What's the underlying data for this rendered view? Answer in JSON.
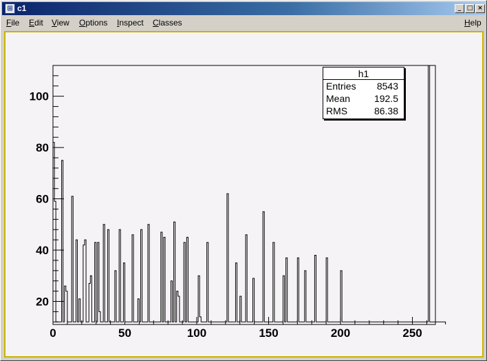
{
  "window": {
    "title": "c1",
    "icon": "root-canvas-icon",
    "controls": [
      "minimize-icon",
      "maximize-icon",
      "close-icon"
    ]
  },
  "menu": {
    "items": [
      "File",
      "Edit",
      "View",
      "Options",
      "Inspect",
      "Classes"
    ],
    "help": "Help"
  },
  "stats": {
    "title": "h1",
    "rows": [
      {
        "key": "Entries",
        "value": "8543"
      },
      {
        "key": "Mean",
        "value": "192.5"
      },
      {
        "key": "RMS",
        "value": "86.38"
      }
    ]
  },
  "chart_data": {
    "type": "bar",
    "title": "",
    "xlabel": "",
    "ylabel": "",
    "xlim": [
      0,
      266
    ],
    "ylim": [
      11,
      112
    ],
    "bin_width": 1,
    "x_ticks": [
      0,
      50,
      100,
      150,
      200,
      250
    ],
    "y_ticks": [
      20,
      40,
      60,
      80,
      100
    ],
    "grid": false,
    "values": [
      82,
      59,
      12,
      12,
      12,
      12,
      75,
      12,
      26,
      24,
      12,
      12,
      12,
      61,
      12,
      12,
      44,
      12,
      21,
      12,
      12,
      42,
      44,
      12,
      12,
      27,
      30,
      12,
      12,
      43,
      12,
      43,
      16,
      12,
      12,
      50,
      12,
      12,
      48,
      12,
      12,
      12,
      12,
      32,
      12,
      12,
      48,
      12,
      12,
      35,
      12,
      12,
      12,
      12,
      12,
      46,
      12,
      12,
      12,
      21,
      12,
      48,
      12,
      12,
      12,
      12,
      50,
      12,
      12,
      12,
      12,
      12,
      12,
      12,
      12,
      47,
      12,
      45,
      12,
      12,
      12,
      12,
      28,
      12,
      51,
      12,
      24,
      22,
      12,
      12,
      12,
      43,
      12,
      45,
      12,
      12,
      12,
      12,
      12,
      12,
      12,
      30,
      14,
      12,
      12,
      12,
      12,
      43,
      12,
      12,
      12,
      12,
      12,
      12,
      12,
      12,
      12,
      12,
      12,
      12,
      12,
      62,
      12,
      12,
      12,
      12,
      12,
      35,
      12,
      12,
      22,
      12,
      12,
      12,
      46,
      12,
      12,
      12,
      12,
      29,
      12,
      12,
      12,
      12,
      12,
      12,
      55,
      12,
      12,
      12,
      12,
      12,
      12,
      43,
      12,
      12,
      12,
      12,
      12,
      12,
      30,
      12,
      37,
      12,
      12,
      12,
      12,
      12,
      12,
      12,
      37,
      12,
      12,
      12,
      12,
      32,
      12,
      12,
      12,
      12,
      12,
      12,
      38,
      12,
      12,
      12,
      12,
      12,
      12,
      12,
      37,
      12,
      12,
      12,
      12,
      12,
      12,
      12,
      12,
      12,
      32,
      12,
      12,
      12,
      12,
      12,
      12,
      12,
      12,
      12,
      12,
      12,
      12,
      12,
      12,
      12,
      12,
      12,
      12,
      12,
      12,
      12,
      12,
      12,
      12,
      12,
      12,
      12,
      12,
      12,
      12,
      12,
      12,
      12,
      12,
      12,
      12,
      12,
      12,
      12,
      12,
      12,
      12,
      12,
      12,
      12,
      12,
      12,
      12,
      12,
      12,
      12,
      12,
      12,
      12,
      12,
      12,
      12,
      12,
      12,
      12,
      112,
      12,
      12,
      12,
      12,
      12,
      12,
      12,
      12,
      12,
      12,
      12
    ]
  }
}
